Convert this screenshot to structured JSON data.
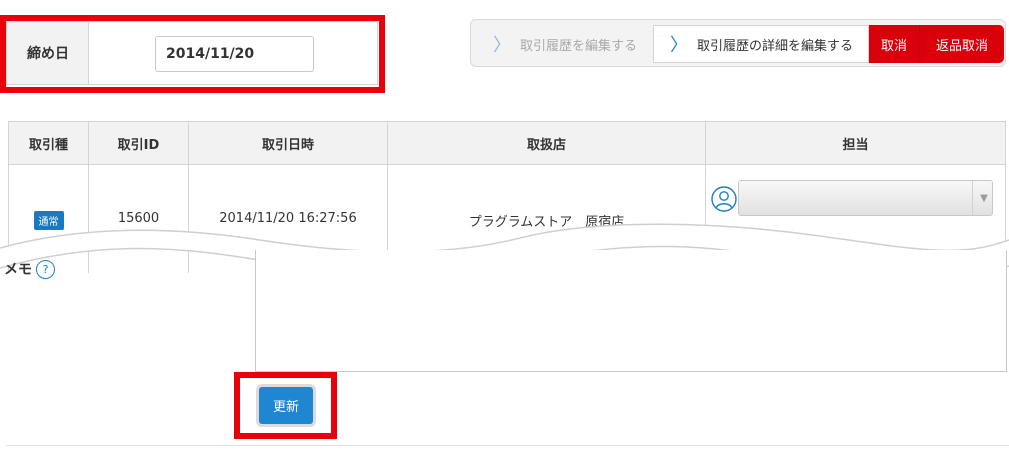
{
  "closing_date": {
    "label": "締め日",
    "value": "2014/11/20"
  },
  "actions": {
    "edit_history": "取引履歴を編集する",
    "edit_history_detail": "取引履歴の詳細を編集する",
    "cancel": "取消",
    "return_cancel": "返品取消",
    "chevron_glyph": "〉"
  },
  "table": {
    "headers": [
      "取引種",
      "取引ID",
      "取引日時",
      "取扱店",
      "担当"
    ],
    "row": {
      "type_badge": "通常",
      "transaction_id": "15600",
      "datetime": "2014/11/20 16:27:56",
      "store": "プラグラムストア　原宿店",
      "staff": ""
    }
  },
  "memo": {
    "label": "メモ",
    "help_glyph": "?",
    "value": ""
  },
  "update_button": "更新",
  "colors": {
    "accent_blue": "#1f86d1",
    "danger_red": "#d9000b",
    "highlight_red": "#e8000b"
  }
}
